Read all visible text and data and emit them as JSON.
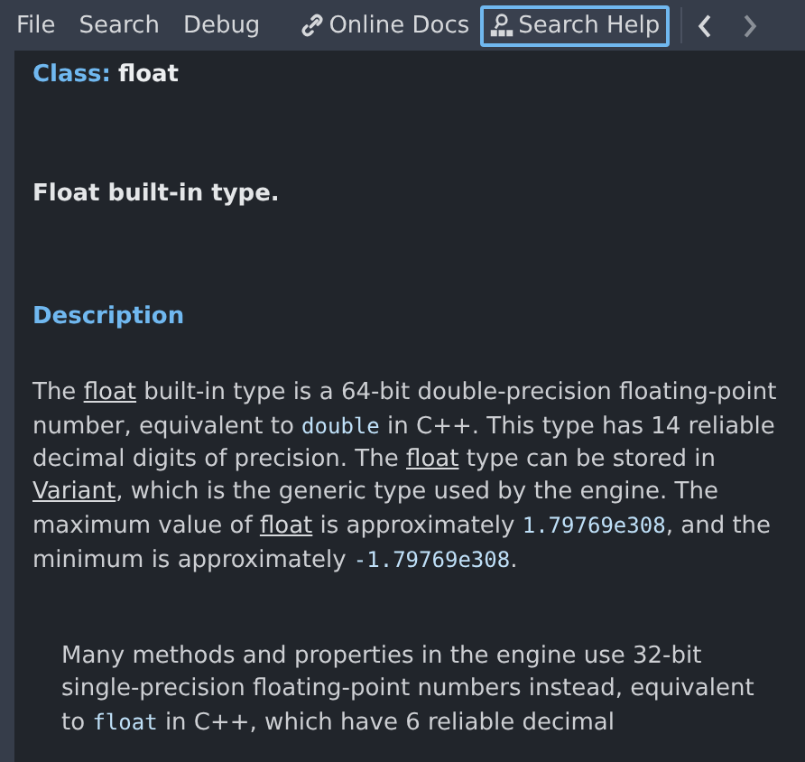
{
  "menu": [
    {
      "label": "File"
    },
    {
      "label": "Search"
    },
    {
      "label": "Debug"
    }
  ],
  "toolbar_buttons": [
    {
      "label": "Online Docs",
      "kind": "link",
      "focused": false
    },
    {
      "label": "Search Help",
      "kind": "doc",
      "focused": true
    }
  ],
  "class_heading": {
    "prefix": "Class:",
    "name": "float"
  },
  "brief": "Float built-in type.",
  "section_title": "Description",
  "paragraphs": [
    {
      "indented": false,
      "segments": [
        {
          "kind": "text",
          "text": "The "
        },
        {
          "kind": "link",
          "text": "float"
        },
        {
          "kind": "text",
          "text": " built-in type is a 64-bit double-precision floating-point number, equivalent to "
        },
        {
          "kind": "code",
          "text": "double"
        },
        {
          "kind": "text",
          "text": " in C++. This type has 14 reliable decimal digits of precision. The "
        },
        {
          "kind": "link",
          "text": "float"
        },
        {
          "kind": "text",
          "text": " type can be stored in "
        },
        {
          "kind": "link",
          "text": "Variant"
        },
        {
          "kind": "text",
          "text": ", which is the generic type used by the engine. The maximum value of "
        },
        {
          "kind": "link",
          "text": "float"
        },
        {
          "kind": "text",
          "text": " is approximately "
        },
        {
          "kind": "code",
          "text": "1.79769e308"
        },
        {
          "kind": "text",
          "text": ", and the minimum is approximately "
        },
        {
          "kind": "code",
          "text": "-1.79769e308"
        },
        {
          "kind": "text",
          "text": "."
        }
      ]
    },
    {
      "indented": true,
      "segments": [
        {
          "kind": "text",
          "text": "Many methods and properties in the engine use 32-bit single-precision floating-point numbers instead, equivalent to "
        },
        {
          "kind": "code",
          "text": "float"
        },
        {
          "kind": "text",
          "text": " in C++, which have 6 reliable decimal"
        }
      ]
    }
  ]
}
